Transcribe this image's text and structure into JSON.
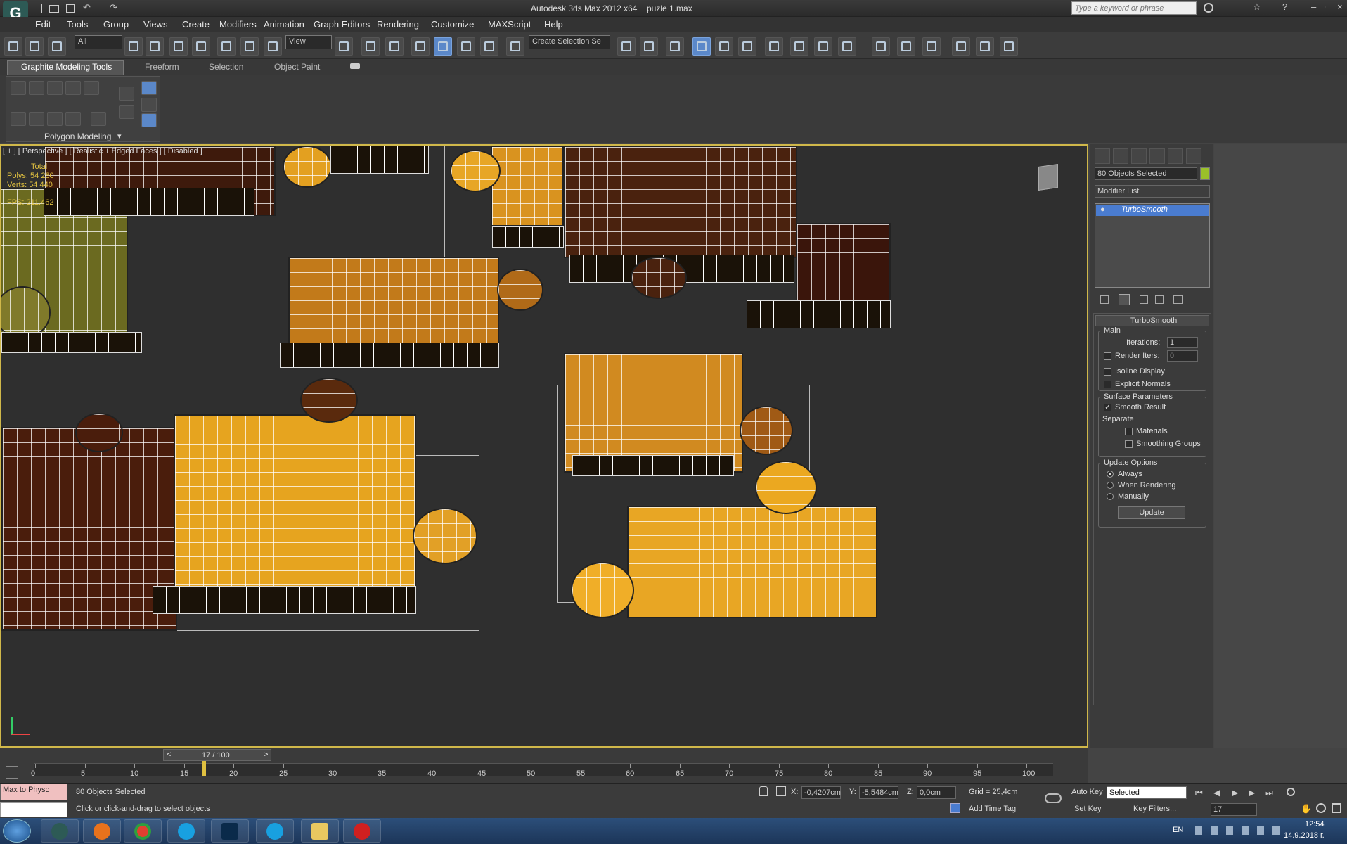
{
  "title": {
    "app": "Autodesk 3ds Max  2012 x64",
    "file": "puzle 1.max",
    "search_placeholder": "Type a keyword or phrase"
  },
  "menu": [
    "Edit",
    "Tools",
    "Group",
    "Views",
    "Create",
    "Modifiers",
    "Animation",
    "Graph Editors",
    "Rendering",
    "Customize",
    "MAXScript",
    "Help"
  ],
  "toolbar": {
    "filter": "All",
    "refcoord": "View",
    "selection_set": "Create Selection Se"
  },
  "ribbon": {
    "tabs": [
      "Graphite Modeling Tools",
      "Freeform",
      "Selection",
      "Object Paint"
    ],
    "panel_label": "Polygon Modeling"
  },
  "viewport": {
    "label": "[ + ] [ Perspective ] [ Realistic + Edged Faces ] [ Disabled ]",
    "stats": {
      "total": "Total",
      "polys_label": "Polys:",
      "polys": "54 280",
      "verts_label": "Verts:",
      "verts": "54 440",
      "fps_label": "FPS:",
      "fps": "211.462"
    }
  },
  "command_panel": {
    "selection": "80 Objects Selected",
    "modifier_list": "Modifier List",
    "stack_item": "TurboSmooth",
    "rollout_title": "TurboSmooth",
    "main_label": "Main",
    "iterations_label": "Iterations:",
    "iterations": "1",
    "render_iters_label": "Render Iters:",
    "render_iters": "0",
    "isoline": "Isoline Display",
    "explicit": "Explicit Normals",
    "surface_label": "Surface Parameters",
    "smooth_result": "Smooth Result",
    "separate_label": "Separate",
    "materials": "Materials",
    "smoothing_groups": "Smoothing Groups",
    "update_label": "Update Options",
    "always": "Always",
    "when_rendering": "When Rendering",
    "manually": "Manually",
    "update_btn": "Update"
  },
  "timeline": {
    "frame": "17 / 100",
    "ticks": [
      "0",
      "5",
      "10",
      "15",
      "20",
      "25",
      "30",
      "35",
      "40",
      "45",
      "50",
      "55",
      "60",
      "65",
      "70",
      "75",
      "80",
      "85",
      "90",
      "95",
      "100"
    ],
    "current_frame": 17,
    "max_frame": 100
  },
  "status": {
    "listener": "Max to Physc",
    "selected": "80 Objects Selected",
    "prompt": "Click or click-and-drag to select objects",
    "x_label": "X:",
    "x": "-0,4207cm",
    "y_label": "Y:",
    "y": "-5,5484cm",
    "z_label": "Z:",
    "z": "0,0cm",
    "grid": "Grid = 25,4cm",
    "add_time_tag": "Add Time Tag",
    "auto_key": "Auto Key",
    "set_key": "Set Key",
    "key_mode": "Selected",
    "key_filters": "Key Filters...",
    "frame_field": "17"
  },
  "taskbar": {
    "lang": "EN",
    "time": "12:54",
    "date": "14.9.2018 г."
  },
  "colors": {
    "accent": "#5b88c9",
    "viewport_border": "#d0b84a",
    "piece_light": "#e9a520",
    "piece_dark": "#3a1a0a"
  }
}
